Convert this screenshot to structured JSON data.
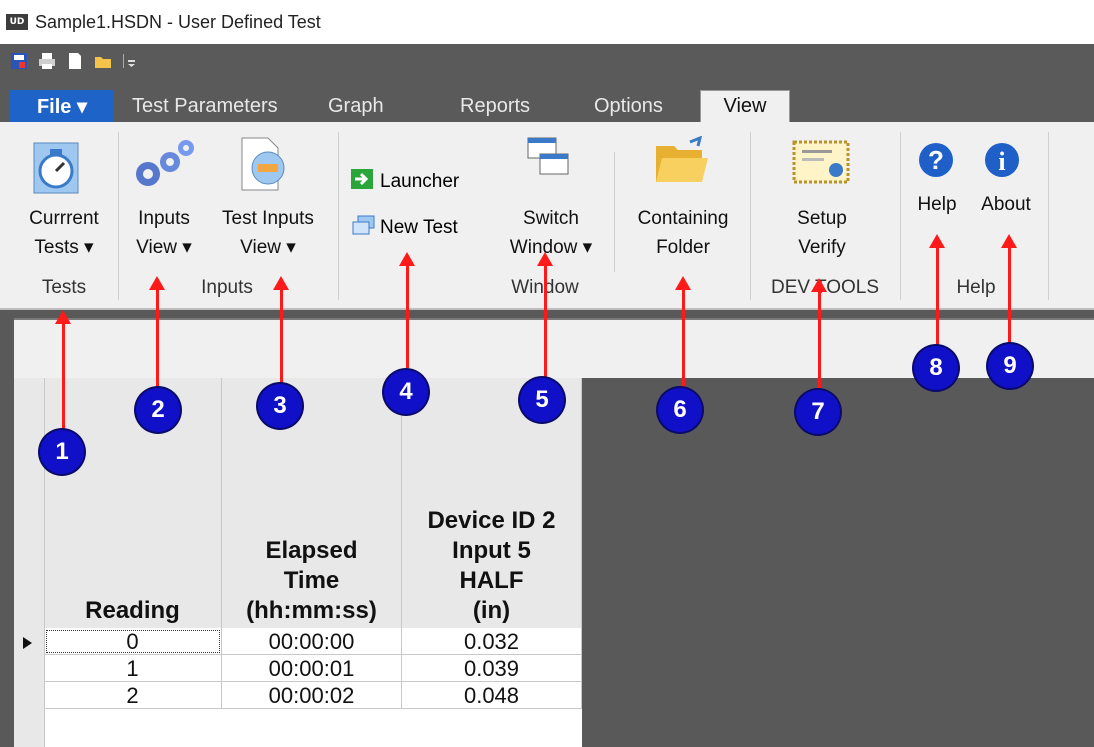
{
  "window": {
    "title": "Sample1.HSDN - User Defined Test",
    "app_icon_text": "UD"
  },
  "tabs": {
    "file": "File ▾",
    "items": [
      {
        "label": "Test Parameters"
      },
      {
        "label": "Graph"
      },
      {
        "label": "Reports"
      },
      {
        "label": "Options"
      },
      {
        "label": "View"
      }
    ]
  },
  "ribbon": {
    "groups": {
      "tests": "Tests",
      "inputs": "Inputs",
      "window": "Window",
      "devtools": "DEV TOOLS",
      "help": "Help"
    },
    "buttons": {
      "current_tests_1": "Currrent",
      "current_tests_2": "Tests ▾",
      "inputs_view_1": "Inputs",
      "inputs_view_2": "View ▾",
      "test_inputs_view_1": "Test Inputs",
      "test_inputs_view_2": "View ▾",
      "launcher": "Launcher",
      "new_test": "New Test",
      "switch_window_1": "Switch",
      "switch_window_2": "Window ▾",
      "containing_folder_1": "Containing",
      "containing_folder_2": "Folder",
      "setup_verify_1": "Setup",
      "setup_verify_2": "Verify",
      "help": "Help",
      "about": "About"
    }
  },
  "grid": {
    "columns": [
      {
        "header": "Reading"
      },
      {
        "header": "Elapsed\nTime\n(hh:mm:ss)"
      },
      {
        "header": "Device ID 2\nInput 5\nHALF\n(in)"
      }
    ],
    "rows": [
      {
        "reading": "0",
        "time": "00:00:00",
        "value": "0.032"
      },
      {
        "reading": "1",
        "time": "00:00:01",
        "value": "0.039"
      },
      {
        "reading": "2",
        "time": "00:00:02",
        "value": "0.048"
      }
    ]
  },
  "annotations": [
    "1",
    "2",
    "3",
    "4",
    "5",
    "6",
    "7",
    "8",
    "9"
  ],
  "colors": {
    "annotation_circle": "#1010c8",
    "annotation_arrow": "#ff1a1a",
    "file_tab": "#1e64c8"
  }
}
